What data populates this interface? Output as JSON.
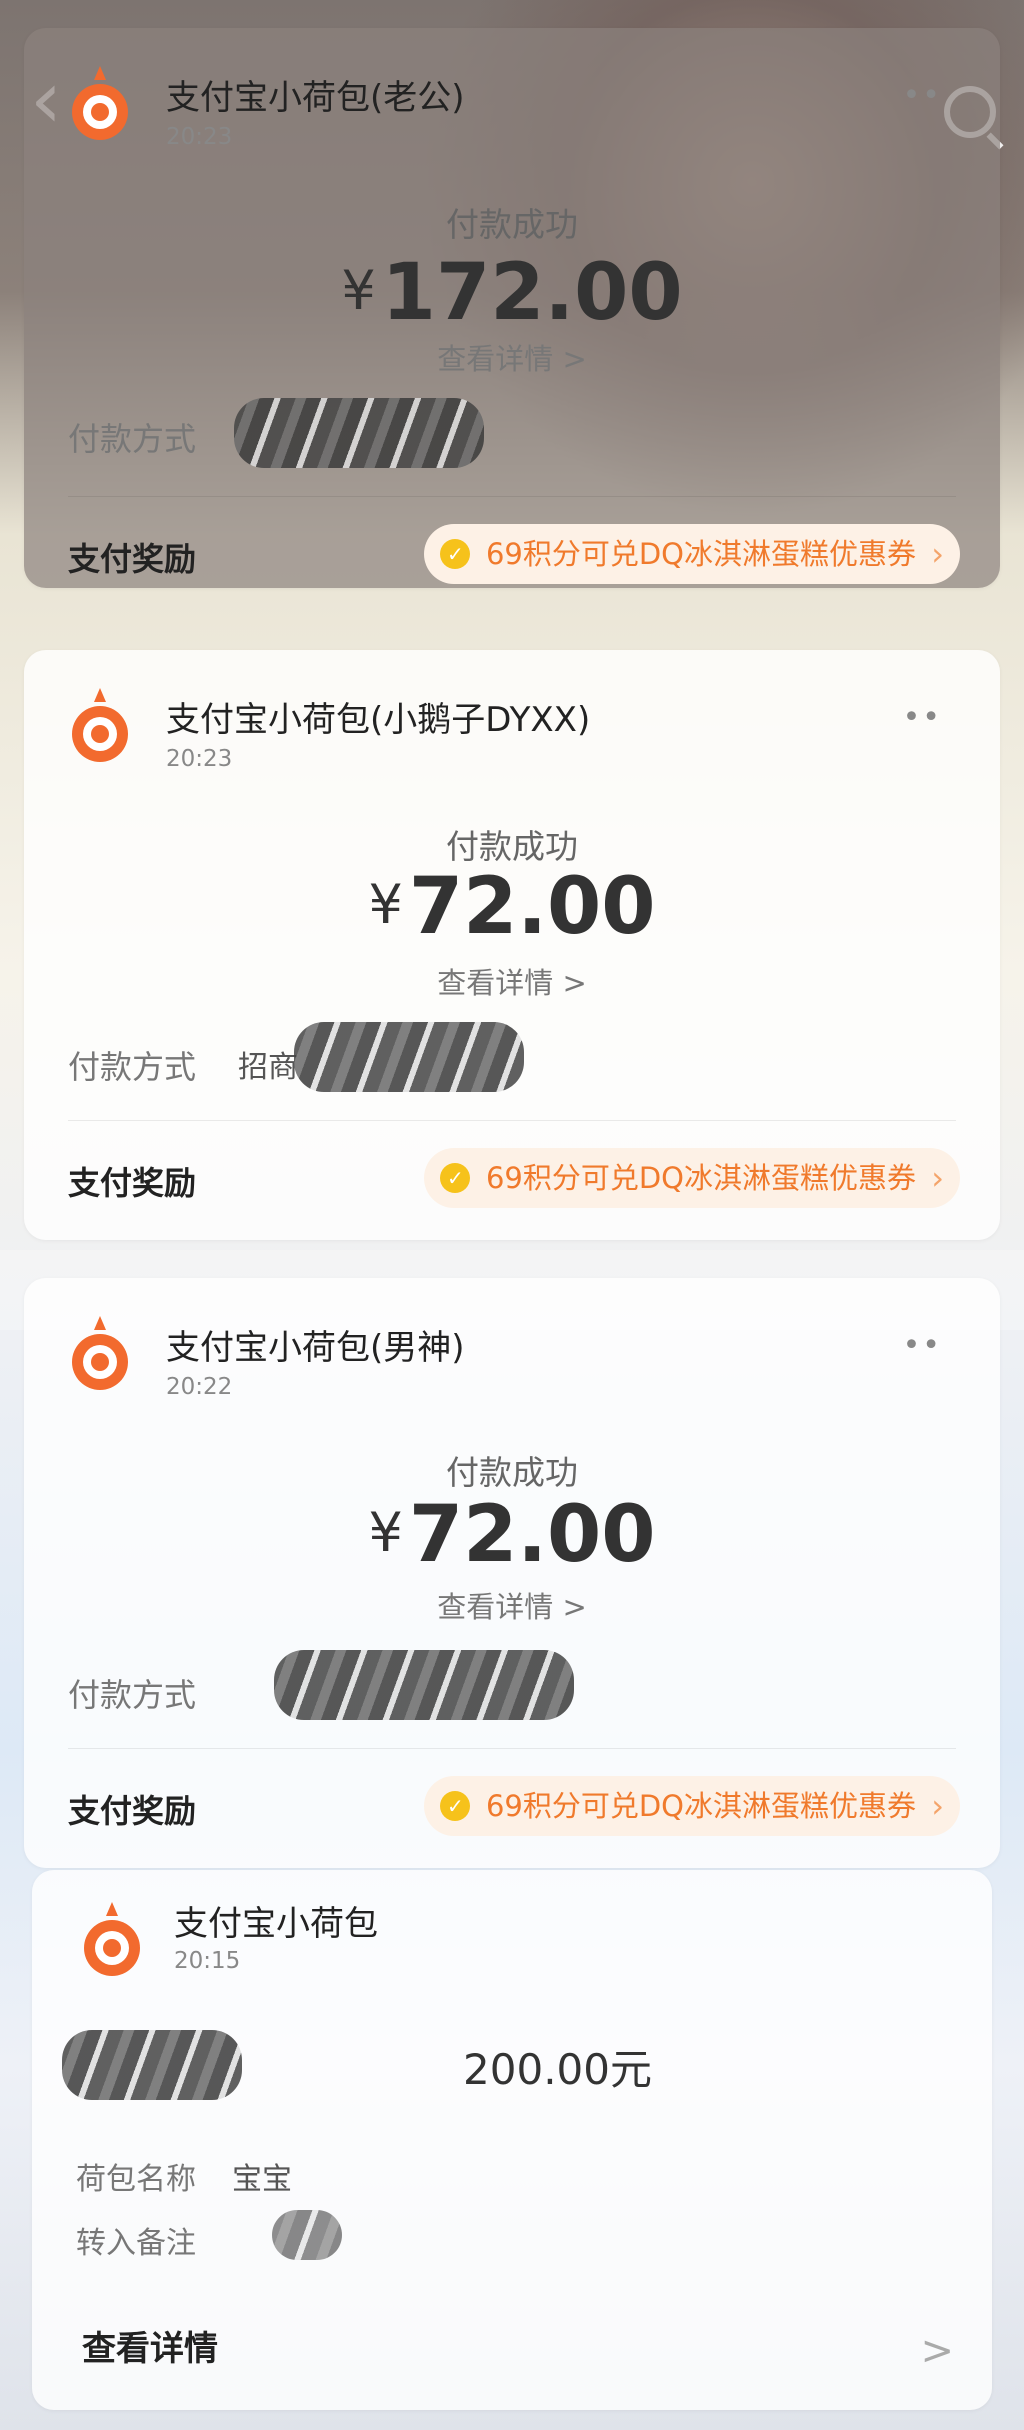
{
  "cards": [
    {
      "merchant": "支付宝小荷包(老公)",
      "time": "20:23",
      "status": "付款成功",
      "currency": "¥",
      "amount": "172.00",
      "detail_link": "查看详情",
      "chevron": ">",
      "method_label": "付款方式",
      "method_value": "",
      "reward_label": "支付奖励",
      "reward_text": "69积分可兑DQ冰淇淋蛋糕优惠券"
    },
    {
      "merchant": "支付宝小荷包(小鹅子DYXX)",
      "time": "20:23",
      "status": "付款成功",
      "currency": "¥",
      "amount": "72.00",
      "detail_link": "查看详情",
      "chevron": ">",
      "method_label": "付款方式",
      "method_value": "招商",
      "reward_label": "支付奖励",
      "reward_text": "69积分可兑DQ冰淇淋蛋糕优惠券"
    },
    {
      "merchant": "支付宝小荷包(男神)",
      "time": "20:22",
      "status": "付款成功",
      "currency": "¥",
      "amount": "72.00",
      "detail_link": "查看详情",
      "chevron": ">",
      "method_label": "付款方式",
      "method_value": "",
      "reward_label": "支付奖励",
      "reward_text": "69积分可兑DQ冰淇淋蛋糕优惠券"
    }
  ],
  "transfer_card": {
    "merchant": "支付宝小荷包",
    "time": "20:15",
    "amount": "200.00元",
    "wallet_name_label": "荷包名称",
    "wallet_name_value": "宝宝",
    "note_label": "转入备注",
    "view_detail": "查看详情",
    "chevron": ">"
  },
  "more_icon": "••",
  "colors": {
    "reward_text": "#f07a2c",
    "reward_bg": "#fdf1e6",
    "logo_orange": "#f26a2e"
  },
  "icons": [
    "back-icon",
    "search-icon",
    "alipay-wallet-logo",
    "more-icon",
    "coin-icon",
    "chevron-right-icon"
  ]
}
